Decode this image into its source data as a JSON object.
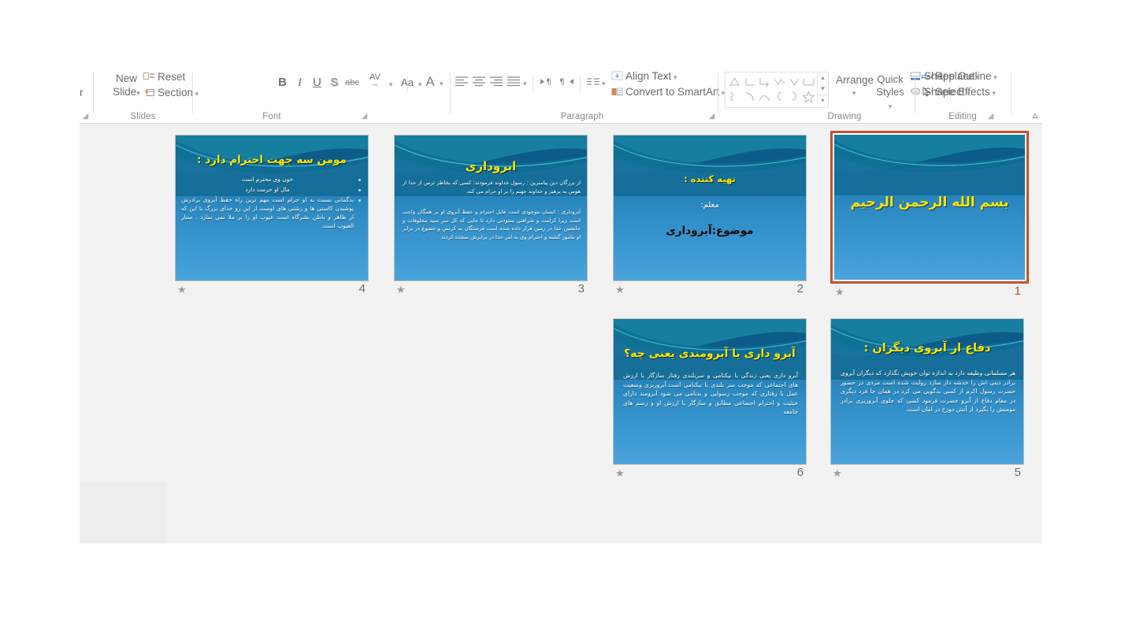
{
  "app": {
    "name": "PowerPoint",
    "view": "Slide Sorter"
  },
  "ribbon": {
    "collapse_icon": "chevron-up-icon",
    "groups": [
      {
        "id": "slides",
        "label": "Slides",
        "commands": {
          "new_slide": "New",
          "new_slide_line2": "Slide",
          "reset": "Reset",
          "section": "Section"
        }
      },
      {
        "id": "font",
        "label": "Font",
        "commands": {
          "bold": "B",
          "italic": "I",
          "underline": "U",
          "shadow": "S",
          "strikethrough": "abc",
          "character_spacing": "AV",
          "change_case": "Aa",
          "font_color": "A"
        }
      },
      {
        "id": "paragraph",
        "label": "Paragraph",
        "commands": {
          "align_text": "Align Text",
          "convert_to_smartart": "Convert to SmartArt"
        }
      },
      {
        "id": "drawing",
        "label": "Drawing",
        "commands": {
          "arrange": "Arrange",
          "quick_styles_line1": "Quick",
          "quick_styles_line2": "Styles",
          "shape_outline": "Shape Outline",
          "shape_effects": "Shape Effects"
        }
      },
      {
        "id": "editing",
        "label": "Editing",
        "commands": {
          "replace": "Replace",
          "select": "Select"
        }
      }
    ]
  },
  "slides": [
    {
      "number": "4",
      "selected": false,
      "layout": "title-and-bullets",
      "title": "مومن سه جهت احترام دارد :",
      "bullets": [
        "خون وی محترم است",
        "مال او حرمت دارد",
        "بدگماني نسبت به او حرام است مهم ترين راه حفظ آبروی برادرش پوشيدن كاستی ها و زشتی های اوست از اين رو خدای بزرگ با اين كه از ظاهر و باطن بشرگاه است عيوب او را بر ملا نمی سازد . ستار العيوب است."
      ]
    },
    {
      "number": "3",
      "selected": false,
      "layout": "title-and-paragraphs",
      "title": "ابروداری",
      "paragraphs": [
        "از بزرگان دين پيامبرين : رسول خداوند فرمودند: كسی كه بخاطر ترس از خدا از هوس به پرهيز و خداوند جهنم را بر او حرام می كند.",
        "آبروداری : انسان موجودی است قابل احترام و حفظ آبروی او بر همگان واجب است زيرا كرامت و شرافتی ستودنی دارد تا جايی كه كل سر سيد مخلوقات و جانشين خدا در زمين قرار داده شده است فرشتگان به كرنش و خضوع در برابر او مامور گشته و احترام وی به امر خدا در برابرش سجده كردند"
      ]
    },
    {
      "number": "2",
      "selected": false,
      "layout": "title-page",
      "title": "تهیه کننده :",
      "subtitle_white": "معلم:",
      "subtitle_black": "موضوع:آبروداری"
    },
    {
      "number": "1",
      "selected": true,
      "layout": "bismillah",
      "title": "بسم الله الرحمن الرحیم"
    },
    {
      "number": "6",
      "selected": false,
      "layout": "title-and-paragraphs",
      "title": "آبرو داری یا آبرومندی یعنی چه؟",
      "paragraphs": [
        "آبرو داری یعنی زندگی با نيكنامی و سربلندی رفتار سازگار با ارزش های اجتماعی كه موجب سر بلندی با نيكنامی است.آبروريزی وضعيت عمل يا رفتاری كه موجب رسوايی و بدنامی می شود آبرومند دارای حيثيت و احترام اجتماعی مطابق و سازگار با ارزش او و رسم های جامعه"
      ]
    },
    {
      "number": "5",
      "selected": false,
      "layout": "title-and-paragraphs",
      "title": "دفاع از آبروی دیگران :",
      "paragraphs": [
        "هر مسلمانی وظيفه دارد به اندازه توان خويش نگذارد كه ديگران آبروی برادر دينی اش را خدشه دار سازد روايت شده است مردی در حضور حضرت رسول اكرم از كسی بدگويی می كرد در همان جا فرد ديگری در مقام دفاع از آبرو حضرت فرمود كسی كه جلوی آبروريزی برادر مومنش را بگيرد از آتش دوزخ در امان است."
      ]
    }
  ],
  "colors": {
    "selection_border": "#c1532c",
    "slide_title_yellow": "#ffe400",
    "slide_bg_top": "#0e5a86",
    "slide_bg_bottom": "#4ba4da",
    "workspace_bg": "#f2f2f2"
  }
}
